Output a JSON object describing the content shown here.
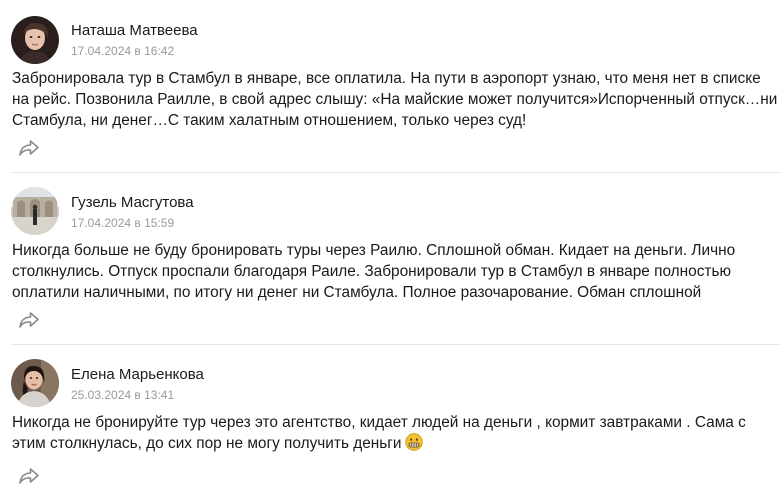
{
  "reviews": [
    {
      "author": "Наташа Матвеева",
      "date": "17.04.2024 в 16:42",
      "text": "Забронировала тур в Стамбул в январе, все оплатила. На пути в аэропорт узнаю, что меня нет в списке на рейс. Позвонила Раилле, в свой адрес слышу: «На майские может получится»Испорченный отпуск…ни Стамбула, ни денег…С таким халатным отношением, только через суд!",
      "share_icon": "share-icon"
    },
    {
      "author": "Гузель Масгутова",
      "date": "17.04.2024 в 15:59",
      "text": "Никогда больше не буду бронировать туры через Раилю. Сплошной обман. Кидает на деньги. Лично столкнулись. Отпуск проспали благодаря Раиле. Забронировали тур в Стамбул в январе полностью оплатили наличными, по итогу ни денег ни Стамбула. Полное разочарование. Обман сплошной",
      "share_icon": "share-icon"
    },
    {
      "author": "Елена Марьенкова",
      "date": "25.03.2024 в 13:41",
      "text": "Никогда не бронируйте тур через это агентство, кидает людей на деньги , кормит завтраками . Сама с этим столкнулась, до сих пор не могу получить деньги",
      "emoji": "grimacing-face",
      "share_icon": "share-icon"
    }
  ],
  "colors": {
    "text": "#1a1a1a",
    "date": "#9a9a9a",
    "divider": "#e6e6e6",
    "share_icon": "#8a8a8a"
  }
}
